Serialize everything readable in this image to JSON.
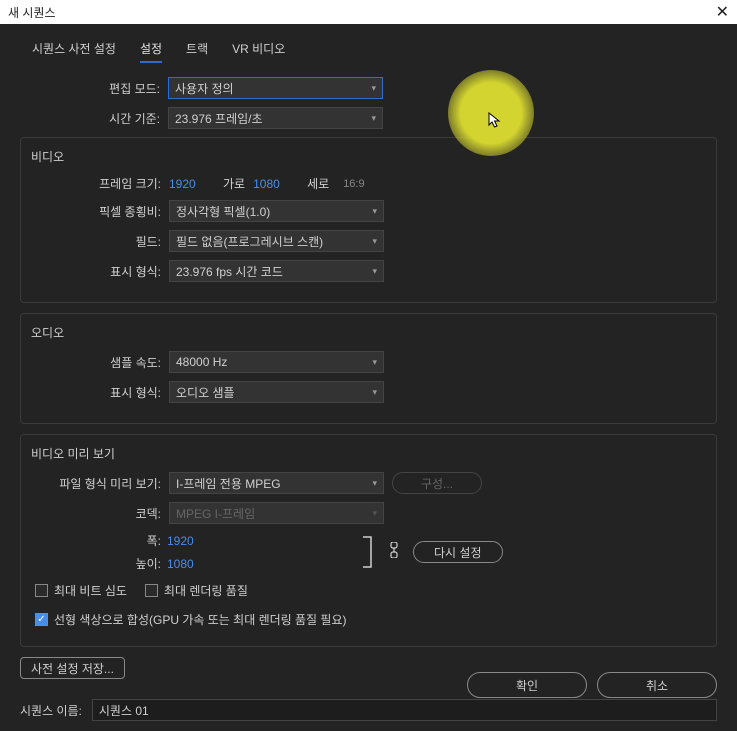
{
  "window": {
    "title": "새 시퀀스"
  },
  "tabs": {
    "preset": "시퀀스 사전 설정",
    "settings": "설정",
    "tracks": "트랙",
    "vr": "VR 비디오"
  },
  "general": {
    "edit_mode_label": "편집 모드:",
    "edit_mode_value": "사용자 정의",
    "timebase_label": "시간 기준:",
    "timebase_value": "23.976  프레임/초"
  },
  "video": {
    "section_title": "비디오",
    "frame_size_label": "프레임 크기:",
    "frame_w": "1920",
    "hor_label": "가로",
    "frame_h": "1080",
    "ver_label": "세로",
    "aspect": "16:9",
    "pixel_aspect_label": "픽셀 종횡비:",
    "pixel_aspect_value": "정사각형 픽셀(1.0)",
    "fields_label": "필드:",
    "fields_value": "필드 없음(프로그레시브 스캔)",
    "display_format_label": "표시 형식:",
    "display_format_value": "23.976 fps 시간 코드"
  },
  "audio": {
    "section_title": "오디오",
    "sample_rate_label": "샘플 속도:",
    "sample_rate_value": "48000 Hz",
    "display_format_label": "표시 형식:",
    "display_format_value": "오디오 샘플"
  },
  "preview": {
    "section_title": "비디오 미리 보기",
    "file_format_label": "파일 형식 미리 보기:",
    "file_format_value": "I-프레임 전용 MPEG",
    "configure": "구성...",
    "codec_label": "코덱:",
    "codec_value": "MPEG I-프레임",
    "width_label": "폭:",
    "width_value": "1920",
    "height_label": "높이:",
    "height_value": "1080",
    "reset": "다시 설정",
    "max_bit_depth": "최대 비트 심도",
    "max_render_quality": "최대 렌더링 품질",
    "linear_color": "선형 색상으로 합성(GPU 가속 또는 최대 렌더링 품질 필요)"
  },
  "preset_save": "사전 설정 저장...",
  "sequence": {
    "name_label": "시퀀스 이름:",
    "name_value": "시퀀스 01"
  },
  "buttons": {
    "ok": "확인",
    "cancel": "취소"
  }
}
